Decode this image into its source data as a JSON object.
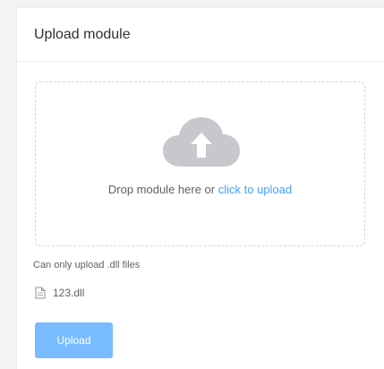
{
  "card": {
    "title": "Upload module"
  },
  "dropzone": {
    "icon": "upload-cloud-icon",
    "prompt": "Drop module here or",
    "link": "click to upload"
  },
  "tip": "Can only upload .dll files",
  "file": {
    "icon": "document-icon",
    "name": "123.dll"
  },
  "upload_button": {
    "label": "Upload"
  },
  "colors": {
    "accent": "#409eff",
    "button": "#79bbff",
    "icon_gray": "#c0c4cc"
  }
}
